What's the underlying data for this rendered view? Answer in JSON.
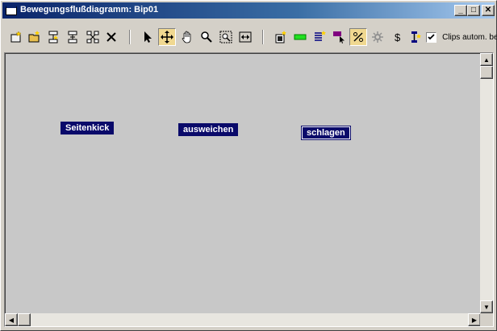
{
  "window": {
    "title": "Bewegungsflußdiagramm: Bip01",
    "minimize_glyph": "_",
    "maximize_glyph": "□",
    "close_glyph": "✕"
  },
  "toolbar": {
    "buttons": [
      {
        "name": "new-clip-icon"
      },
      {
        "name": "open-clip-icon"
      },
      {
        "name": "create-transition-icon"
      },
      {
        "name": "insert-transition-icon"
      },
      {
        "name": "delete-transitions-icon"
      },
      {
        "name": "delete-icon"
      },
      {
        "name": "select-icon"
      },
      {
        "name": "move-icon",
        "active": true
      },
      {
        "name": "pan-hand-icon"
      },
      {
        "name": "zoom-icon"
      },
      {
        "name": "zoom-region-icon"
      },
      {
        "name": "fit-width-icon"
      },
      {
        "name": "create-script-icon"
      },
      {
        "name": "green-bar-icon"
      },
      {
        "name": "list-icon"
      },
      {
        "name": "purple-flag-icon"
      },
      {
        "name": "percent-icon",
        "active": true
      },
      {
        "name": "gear-icon"
      },
      {
        "name": "dollar-icon"
      },
      {
        "name": "info-icon"
      }
    ],
    "auto_clips_checked": true,
    "auto_clips_label": "Clips autom. be"
  },
  "canvas": {
    "nodes": [
      {
        "label": "Seitenkick",
        "selected": false
      },
      {
        "label": "ausweichen",
        "selected": false
      },
      {
        "label": "schlagen",
        "selected": true
      }
    ]
  },
  "colors": {
    "titlebar": "#0a246a",
    "node_fill": "#0a0a6a",
    "canvas_bg": "#c8c8c8"
  }
}
